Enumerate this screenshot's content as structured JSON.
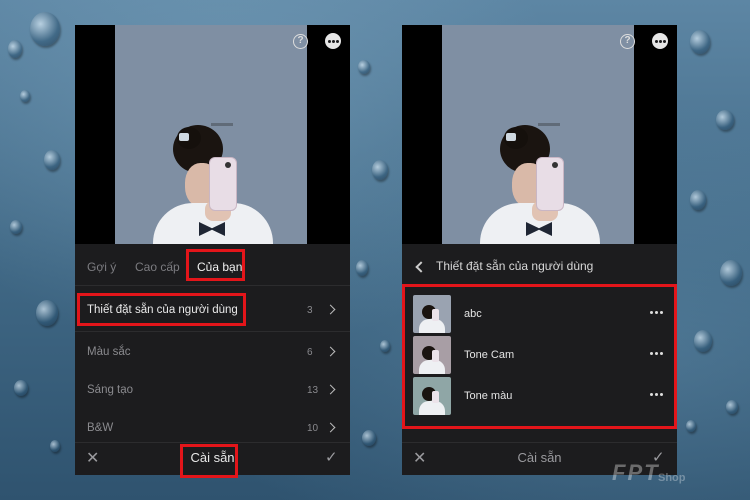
{
  "left_screen": {
    "tabs": [
      {
        "label": "Gợi ý",
        "active": false
      },
      {
        "label": "Cao cấp",
        "active": false
      },
      {
        "label": "Của bạn",
        "active": true
      }
    ],
    "groups": [
      {
        "label": "Thiết đặt sẵn của người dùng",
        "count": "3"
      },
      {
        "label": "Màu sắc",
        "count": "6"
      },
      {
        "label": "Sáng tạo",
        "count": "13"
      },
      {
        "label": "B&W",
        "count": "10"
      }
    ],
    "bottom_bar": {
      "title": "Cài sẵn",
      "cancel_icon": "close-icon",
      "confirm_icon": "check-icon"
    }
  },
  "right_screen": {
    "header": {
      "title": "Thiết đặt sẵn của người dùng",
      "back_icon": "back-chevron-icon"
    },
    "presets": [
      {
        "name": "abc",
        "thumb_color": "#9aa3b1"
      },
      {
        "name": "Tone Cam",
        "thumb_color": "#a89ea5"
      },
      {
        "name": "Tone màu",
        "thumb_color": "#8fa6a6"
      }
    ],
    "bottom_bar": {
      "title": "Cài sẵn",
      "cancel_icon": "close-icon",
      "confirm_icon": "check-icon"
    }
  },
  "highlight_color": "#e3151a",
  "watermark": {
    "brand": "FPT",
    "sub": "Shop"
  }
}
